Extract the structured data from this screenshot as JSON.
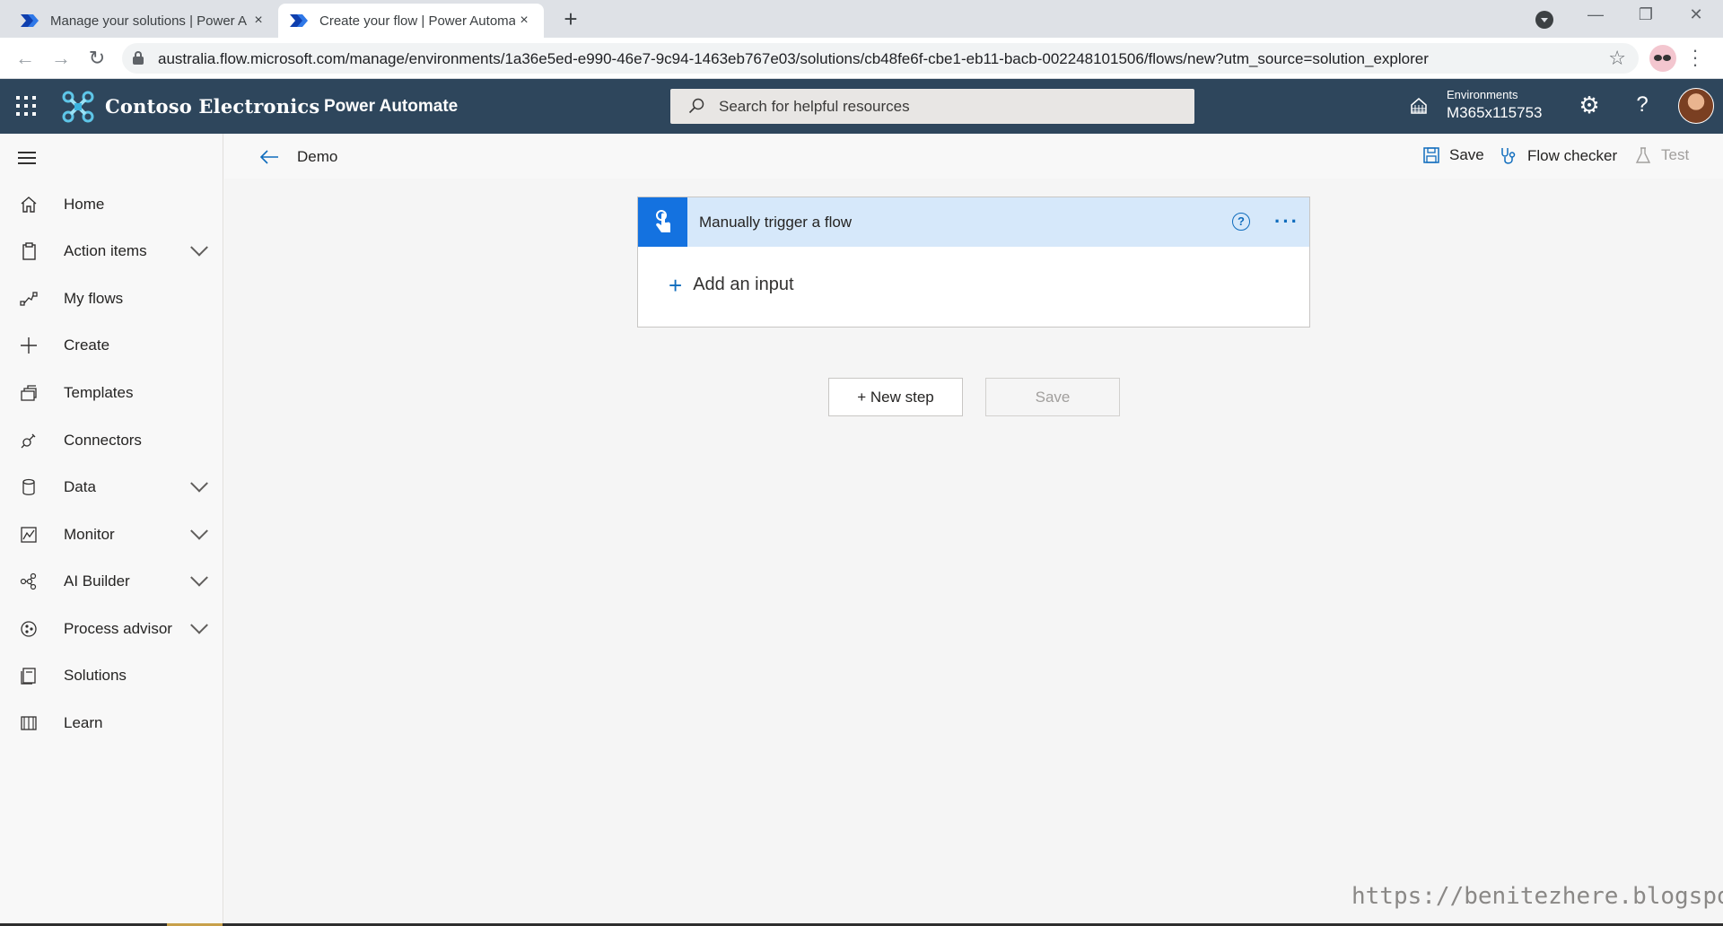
{
  "browser": {
    "tabs": [
      {
        "title": "Manage your solutions | Power A",
        "active": false
      },
      {
        "title": "Create your flow | Power Automa",
        "active": true
      }
    ],
    "close_glyph": "×",
    "new_tab_glyph": "+",
    "url": "australia.flow.microsoft.com/manage/environments/1a36e5ed-e990-46e7-9c94-1463eb767e03/solutions/cb48fe6f-cbe1-eb11-bacb-002248101506/flows/new?utm_source=solution_explorer"
  },
  "header": {
    "brand": "Contoso Electronics",
    "product": "Power Automate",
    "search_placeholder": "Search for helpful resources",
    "environments_label": "Environments",
    "environment_name": "M365x115753",
    "help_glyph": "?"
  },
  "sidebar": {
    "items": [
      {
        "label": "Home",
        "icon": "home-icon",
        "has_chevron": false
      },
      {
        "label": "Action items",
        "icon": "clipboard-icon",
        "has_chevron": true
      },
      {
        "label": "My flows",
        "icon": "flow-icon",
        "has_chevron": false
      },
      {
        "label": "Create",
        "icon": "plus-icon",
        "has_chevron": false
      },
      {
        "label": "Templates",
        "icon": "templates-icon",
        "has_chevron": false
      },
      {
        "label": "Connectors",
        "icon": "connector-icon",
        "has_chevron": false
      },
      {
        "label": "Data",
        "icon": "database-icon",
        "has_chevron": true
      },
      {
        "label": "Monitor",
        "icon": "monitor-icon",
        "has_chevron": true
      },
      {
        "label": "AI Builder",
        "icon": "ai-builder-icon",
        "has_chevron": true
      },
      {
        "label": "Process advisor",
        "icon": "process-advisor-icon",
        "has_chevron": true
      },
      {
        "label": "Solutions",
        "icon": "solutions-icon",
        "has_chevron": false
      },
      {
        "label": "Learn",
        "icon": "book-icon",
        "has_chevron": false
      }
    ]
  },
  "commandbar": {
    "breadcrumb": "Demo",
    "save_label": "Save",
    "flow_checker_label": "Flow checker",
    "test_label": "Test"
  },
  "canvas": {
    "trigger_title": "Manually trigger a flow",
    "trigger_help_glyph": "?",
    "trigger_more_glyph": "···",
    "add_input_plus": "+",
    "add_input_label": "Add an input",
    "new_step_label": "+ New step",
    "save_label": "Save"
  },
  "watermark": "https://benitezhere.blogspot.com",
  "colors": {
    "header_bg": "#2e465c",
    "accent_blue": "#0f6cbd",
    "trigger_header_bg": "#d6e8fa"
  }
}
